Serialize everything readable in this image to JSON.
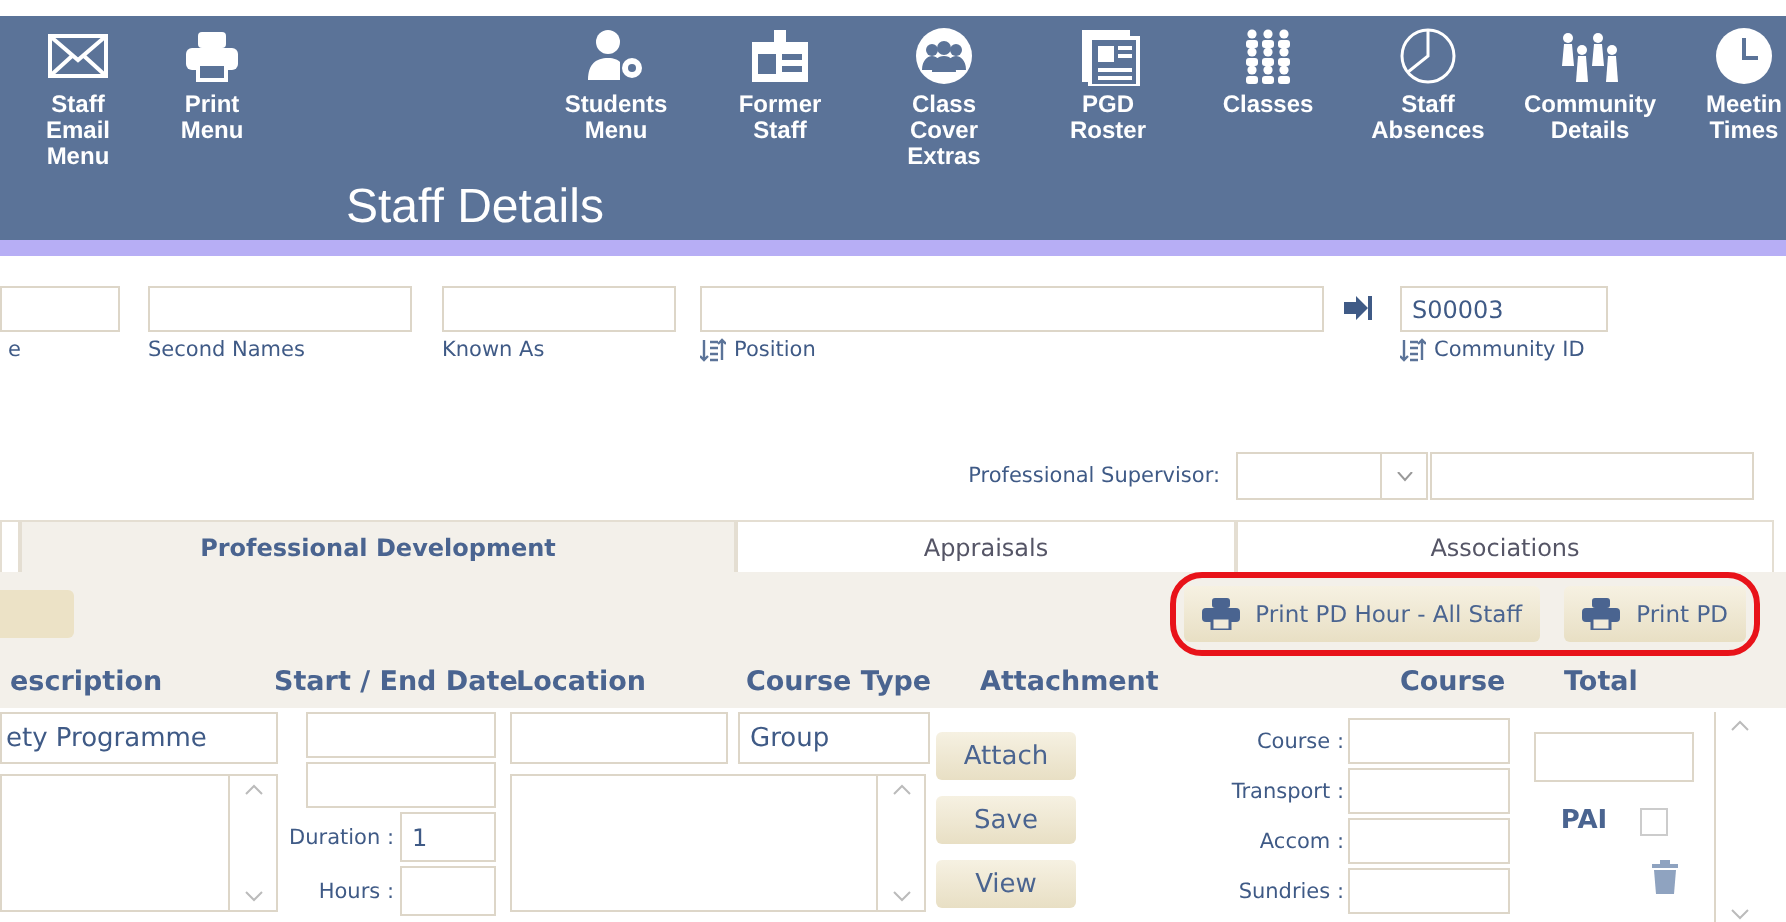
{
  "nav": [
    {
      "kind": "mail",
      "label": "Staff\nEmail\nMenu"
    },
    {
      "kind": "printer",
      "label": "Print\nMenu"
    },
    {
      "kind": "user-gear",
      "label": "Students\nMenu"
    },
    {
      "kind": "badge",
      "label": "Former\nStaff"
    },
    {
      "kind": "group",
      "label": "Class\nCover\nExtras"
    },
    {
      "kind": "document",
      "label": "PGD\nRoster"
    },
    {
      "kind": "people",
      "label": "Classes"
    },
    {
      "kind": "pie",
      "label": "Staff\nAbsences"
    },
    {
      "kind": "family",
      "label": "Community\nDetails"
    },
    {
      "kind": "clock",
      "label": "Meetin\nTimes"
    }
  ],
  "title": "Staff Details",
  "fields": [
    {
      "label": "e",
      "sortable": false
    },
    {
      "label": "Second Names",
      "sortable": false
    },
    {
      "label": "Known As",
      "sortable": false
    },
    {
      "label": "Position",
      "sortable": true
    },
    {
      "label": "Community ID",
      "sortable": true,
      "value": "S00003"
    }
  ],
  "supervisor": {
    "label": "Professional Supervisor:"
  },
  "tabs": [
    {
      "selected": false
    },
    {
      "label": "Professional Development",
      "selected": true
    },
    {
      "label": "Appraisals",
      "selected": false
    },
    {
      "label": "Associations",
      "selected": false
    }
  ],
  "print_buttons": {
    "highlighted": true,
    "labels": [
      "Print PD Hour - All Staff",
      "Print PD"
    ]
  },
  "columns": [
    "escription",
    "Start / End Date",
    "Location",
    "Course Type",
    "Attachment",
    "Course",
    "Total"
  ],
  "record": {
    "description": "ety Programme",
    "duration_label": "Duration :",
    "duration": "1",
    "hours_label": "Hours :",
    "course_type": "Group",
    "actions": [
      "Attach",
      "Save",
      "View"
    ],
    "costs": [
      "Course :",
      "Transport :",
      "Accom :",
      "Sundries :"
    ],
    "pai": {
      "label": "PAI",
      "checked": false
    }
  }
}
